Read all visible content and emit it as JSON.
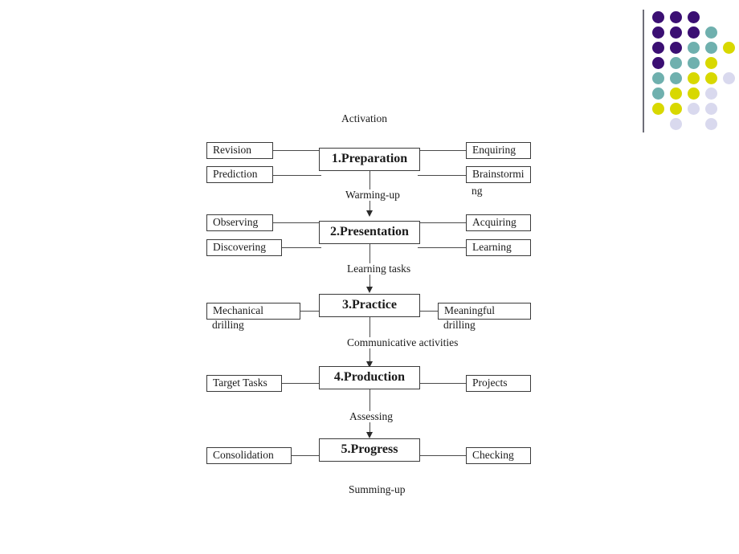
{
  "diagram": {
    "title_label": "Activation",
    "footer_label": "Summing-up",
    "stages": [
      {
        "id": "preparation",
        "center": "1.Preparation",
        "left": [
          "Revision",
          "Prediction"
        ],
        "right": [
          "Enquiring",
          "Brainstormi"
        ],
        "right_overflow": "ng",
        "transition_label": "Warming-up"
      },
      {
        "id": "presentation",
        "center": "2.Presentation",
        "left": [
          "Observing",
          "Discovering"
        ],
        "right": [
          "Acquiring",
          "Learning"
        ],
        "transition_label": "Learning tasks"
      },
      {
        "id": "practice",
        "center": "3.Practice",
        "left": [
          "Mechanical"
        ],
        "left_overflow": "drilling",
        "right": [
          "Meaningful"
        ],
        "right_overflow": "drilling",
        "transition_label": "Communicative activities"
      },
      {
        "id": "production",
        "center": "4.Production",
        "left": [
          "Target Tasks"
        ],
        "right": [
          "Projects"
        ],
        "transition_label": "Assessing"
      },
      {
        "id": "progress",
        "center": "5.Progress",
        "left": [
          "Consolidation"
        ],
        "right": [
          "Checking"
        ],
        "transition_label": ""
      }
    ]
  },
  "decoration": {
    "name": "dot-grid-ornament",
    "rule_color": "#6e6e78",
    "palette": {
      "purple": "#3B0F73",
      "teal": "#6FB0AE",
      "yellow": "#D8D800",
      "lavender": "#D9D9EE"
    },
    "dots": [
      {
        "col": 0,
        "row": 0,
        "color": "#3B0F73"
      },
      {
        "col": 1,
        "row": 0,
        "color": "#3B0F73"
      },
      {
        "col": 2,
        "row": 0,
        "color": "#3B0F73"
      },
      {
        "col": 0,
        "row": 1,
        "color": "#3B0F73"
      },
      {
        "col": 1,
        "row": 1,
        "color": "#3B0F73"
      },
      {
        "col": 2,
        "row": 1,
        "color": "#3B0F73"
      },
      {
        "col": 3,
        "row": 1,
        "color": "#6FB0AE"
      },
      {
        "col": 0,
        "row": 2,
        "color": "#3B0F73"
      },
      {
        "col": 1,
        "row": 2,
        "color": "#3B0F73"
      },
      {
        "col": 2,
        "row": 2,
        "color": "#6FB0AE"
      },
      {
        "col": 3,
        "row": 2,
        "color": "#6FB0AE"
      },
      {
        "col": 4,
        "row": 2,
        "color": "#D8D800"
      },
      {
        "col": 0,
        "row": 3,
        "color": "#3B0F73"
      },
      {
        "col": 1,
        "row": 3,
        "color": "#6FB0AE"
      },
      {
        "col": 2,
        "row": 3,
        "color": "#6FB0AE"
      },
      {
        "col": 3,
        "row": 3,
        "color": "#D8D800"
      },
      {
        "col": 0,
        "row": 4,
        "color": "#6FB0AE"
      },
      {
        "col": 1,
        "row": 4,
        "color": "#6FB0AE"
      },
      {
        "col": 2,
        "row": 4,
        "color": "#D8D800"
      },
      {
        "col": 3,
        "row": 4,
        "color": "#D8D800"
      },
      {
        "col": 4,
        "row": 4,
        "color": "#D9D9EE"
      },
      {
        "col": 0,
        "row": 5,
        "color": "#6FB0AE"
      },
      {
        "col": 1,
        "row": 5,
        "color": "#D8D800"
      },
      {
        "col": 2,
        "row": 5,
        "color": "#D8D800"
      },
      {
        "col": 3,
        "row": 5,
        "color": "#D9D9EE"
      },
      {
        "col": 0,
        "row": 6,
        "color": "#D8D800"
      },
      {
        "col": 1,
        "row": 6,
        "color": "#D8D800"
      },
      {
        "col": 2,
        "row": 6,
        "color": "#D9D9EE"
      },
      {
        "col": 3,
        "row": 6,
        "color": "#D9D9EE"
      },
      {
        "col": 1,
        "row": 7,
        "color": "#D9D9EE"
      },
      {
        "col": 3,
        "row": 7,
        "color": "#D9D9EE"
      }
    ]
  }
}
